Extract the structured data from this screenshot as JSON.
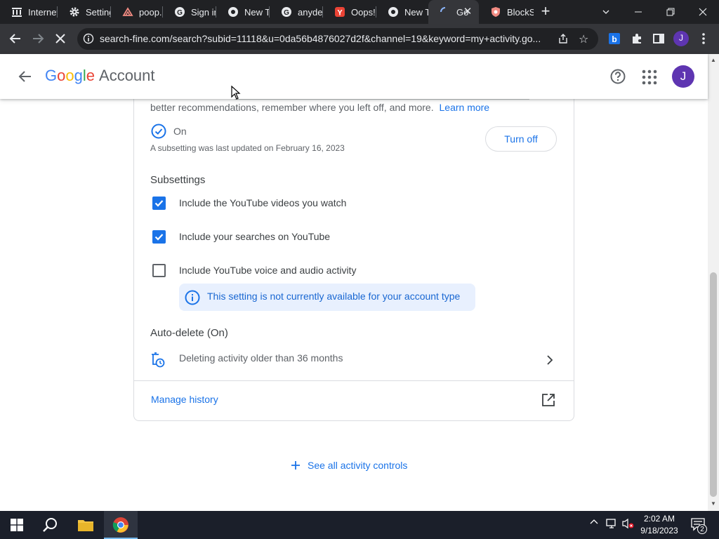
{
  "browser": {
    "tabs": [
      {
        "title": "Internet Archive",
        "icon": "archive-icon"
      },
      {
        "title": "Settings",
        "icon": "gear-icon"
      },
      {
        "title": "poop.",
        "icon": "site-icon"
      },
      {
        "title": "Sign in",
        "icon": "google-icon"
      },
      {
        "title": "New Tab",
        "icon": "chrome-icon"
      },
      {
        "title": "anydesk",
        "icon": "google-icon"
      },
      {
        "title": "Oops!",
        "icon": "yahoo-icon"
      },
      {
        "title": "New Tab",
        "icon": "chrome-icon"
      },
      {
        "title": "Go",
        "icon": "loading-icon",
        "active": true
      },
      {
        "title": "BlockSite",
        "icon": "shield-icon"
      }
    ],
    "url": "search-fine.com/search?subid=11118&u=0da56b4876027d2f&channel=19&keyword=my+activity.go...",
    "profile_initial": "J"
  },
  "header": {
    "logo_letters": [
      "G",
      "o",
      "o",
      "g",
      "l",
      "e"
    ],
    "account_label": "Account",
    "avatar_initial": "J"
  },
  "activity": {
    "description": "better recommendations, remember where you left off, and more.",
    "learn_more": "Learn more",
    "status": "On",
    "last_updated": "A subsetting was last updated on February 16, 2023",
    "turn_off_label": "Turn off",
    "subsettings_title": "Subsettings",
    "subsettings": [
      {
        "label": "Include the YouTube videos you watch",
        "checked": true
      },
      {
        "label": "Include your searches on YouTube",
        "checked": true
      },
      {
        "label": "Include YouTube voice and audio activity",
        "checked": false
      }
    ],
    "notice": "This setting is not currently available for your account type",
    "auto_delete_title": "Auto-delete (On)",
    "auto_delete_text": "Deleting activity older than 36 months",
    "manage_history": "Manage history",
    "see_all": "See all activity controls"
  },
  "taskbar": {
    "time": "2:02 AM",
    "date": "9/18/2023",
    "notification_count": "2"
  },
  "colors": {
    "accent": "#1a73e8",
    "tab_bar": "#202124",
    "toolbar": "#35363a",
    "taskbar": "#1b1f2a"
  }
}
